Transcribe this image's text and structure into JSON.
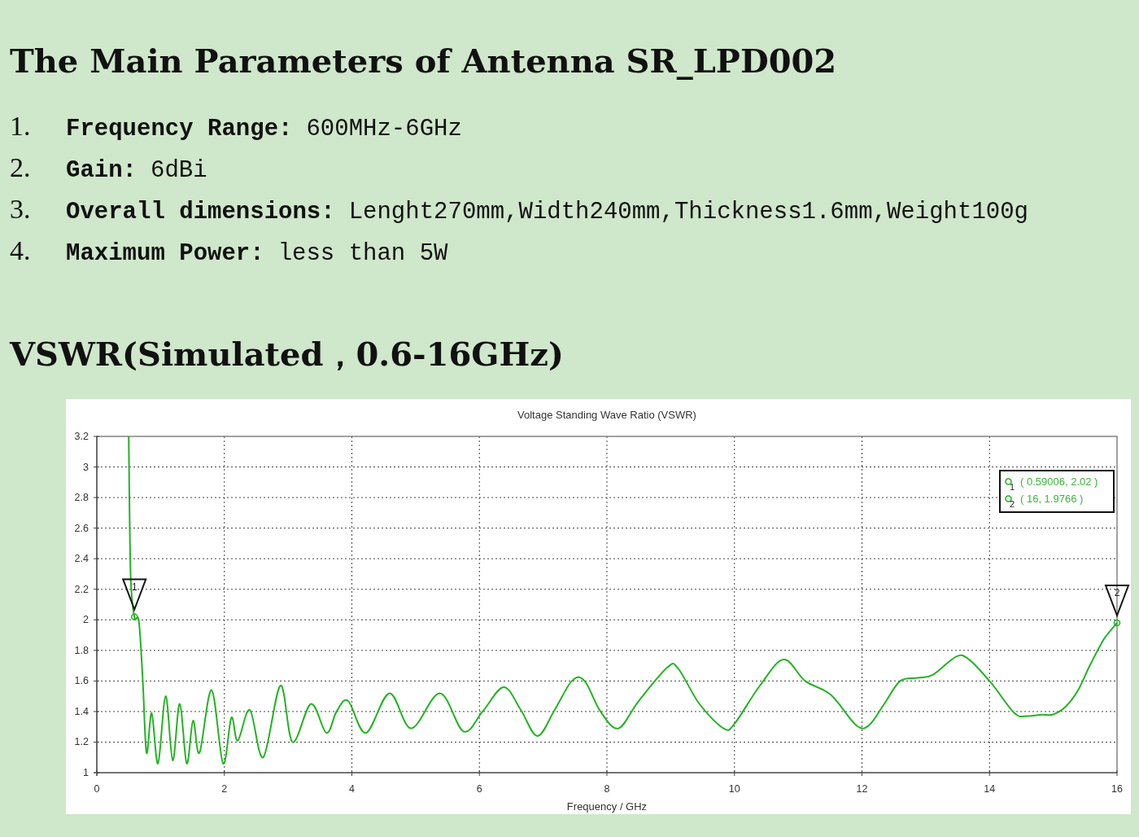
{
  "title": "The Main Parameters of Antenna SR_LPD002",
  "specs": [
    {
      "number": "1.",
      "label": "Frequency Range:",
      "value": "600MHz-6GHz"
    },
    {
      "number": "2.",
      "label": "Gain:",
      "value": "6dBi"
    },
    {
      "number": "3.",
      "label": "Overall dimensions:",
      "value": "Lenght270mm,Width240mm,Thickness1.6mm,Weight100g"
    },
    {
      "number": "4.",
      "label": "Maximum Power:",
      "value": "less than 5W"
    }
  ],
  "section_title": "VSWR(Simulated，0.6-16GHz)",
  "chart": {
    "chart_data": {
      "type": "line",
      "title": "Voltage Standing Wave Ratio (VSWR)",
      "xlabel": "Frequency / GHz",
      "x": [
        0.5,
        0.53,
        0.59,
        0.66,
        0.72,
        0.78,
        0.86,
        0.96,
        1.08,
        1.19,
        1.3,
        1.41,
        1.51,
        1.61,
        1.8,
        1.98,
        2.11,
        2.21,
        2.4,
        2.61,
        2.88,
        3.07,
        3.36,
        3.6,
        3.76,
        3.94,
        4.22,
        4.59,
        4.93,
        5.38,
        5.75,
        6.05,
        6.38,
        6.65,
        6.91,
        7.18,
        7.45,
        7.65,
        7.9,
        8.18,
        8.5,
        8.95,
        9.12,
        9.45,
        9.83,
        10.0,
        10.4,
        10.77,
        11.11,
        11.51,
        11.91,
        12.11,
        12.35,
        12.6,
        12.88,
        13.11,
        13.48,
        13.68,
        14.02,
        14.39,
        14.59,
        14.82,
        14.99,
        15.19,
        15.39,
        15.56,
        15.76,
        15.84,
        16
      ],
      "series": [
        {
          "color": "#22b422",
          "values": [
            3.2,
            2.3,
            2.02,
            1.99,
            1.61,
            1.13,
            1.39,
            1.06,
            1.5,
            1.08,
            1.45,
            1.06,
            1.34,
            1.13,
            1.54,
            1.06,
            1.36,
            1.21,
            1.41,
            1.1,
            1.57,
            1.2,
            1.45,
            1.26,
            1.4,
            1.47,
            1.26,
            1.52,
            1.29,
            1.52,
            1.27,
            1.4,
            1.56,
            1.41,
            1.24,
            1.41,
            1.6,
            1.6,
            1.4,
            1.29,
            1.47,
            1.69,
            1.68,
            1.45,
            1.29,
            1.32,
            1.57,
            1.74,
            1.6,
            1.51,
            1.31,
            1.31,
            1.45,
            1.6,
            1.62,
            1.64,
            1.76,
            1.74,
            1.59,
            1.39,
            1.37,
            1.38,
            1.38,
            1.43,
            1.54,
            1.69,
            1.85,
            1.9,
            1.98
          ]
        }
      ],
      "xlim": [
        0,
        16
      ],
      "ylim": [
        1,
        3.2
      ],
      "xticks": [
        0,
        2,
        4,
        6,
        8,
        10,
        12,
        14,
        16
      ],
      "yticks": [
        1,
        1.2,
        1.4,
        1.6,
        1.8,
        2,
        2.2,
        2.4,
        2.6,
        2.8,
        3,
        3.2
      ],
      "grid": true,
      "annotations": [
        {
          "x": 0.59,
          "y": 2.02,
          "text": "1"
        },
        {
          "x": 16,
          "y": 1.98,
          "text": "2"
        }
      ]
    },
    "legend": [
      {
        "marker": "1",
        "text": "( 0.59006, 2.02 )"
      },
      {
        "marker": "2",
        "text": "( 16, 1.9766 )"
      }
    ]
  }
}
